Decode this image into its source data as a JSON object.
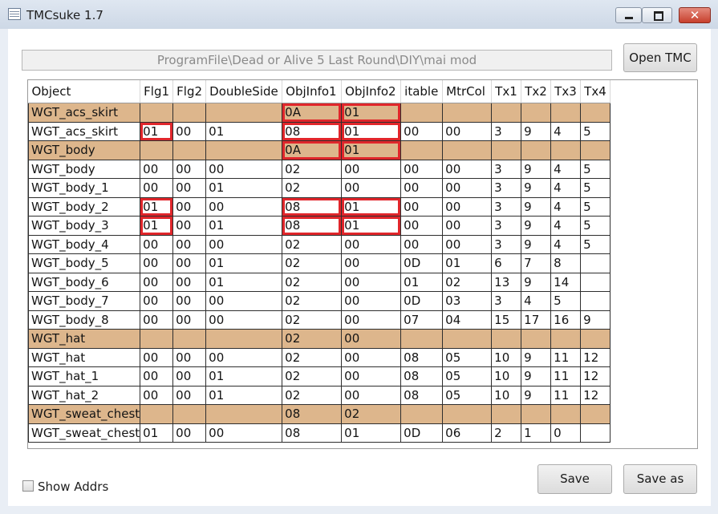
{
  "window": {
    "title": "TMCsuke 1.7",
    "buttons": {
      "minimize": "minimize",
      "maximize": "maximize",
      "close": "✕"
    }
  },
  "path": "ProgramFile\\Dead or Alive 5 Last Round\\DIY\\mai mod",
  "open_button": "Open TMC",
  "save_button": "Save",
  "save_as_button": "Save as",
  "show_addrs_label": "Show Addrs",
  "show_addrs_checked": false,
  "colors": {
    "group_row": "#ddb68c",
    "highlight": "#e0262b"
  },
  "grid": {
    "columns": [
      "Object",
      "Flg1",
      "Flg2",
      "DoubleSide",
      "ObjInfo1",
      "ObjInfo2",
      "itable",
      "MtrCol",
      "Tx1",
      "Tx2",
      "Tx3",
      "Tx4"
    ],
    "rows": [
      {
        "group": true,
        "cells": [
          "WGT_acs_skirt",
          "",
          "",
          "",
          "0A",
          "01",
          "",
          "",
          "",
          "",
          "",
          ""
        ],
        "highlight": [
          4,
          5
        ]
      },
      {
        "group": false,
        "cells": [
          "WGT_acs_skirt",
          "01",
          "00",
          "01",
          "08",
          "01",
          "00",
          "00",
          "3",
          "9",
          "4",
          "5"
        ],
        "highlight": [
          1,
          4,
          5
        ]
      },
      {
        "group": true,
        "cells": [
          "WGT_body",
          "",
          "",
          "",
          "0A",
          "01",
          "",
          "",
          "",
          "",
          "",
          ""
        ],
        "highlight": [
          4,
          5
        ]
      },
      {
        "group": false,
        "cells": [
          "WGT_body",
          "00",
          "00",
          "00",
          "02",
          "00",
          "00",
          "00",
          "3",
          "9",
          "4",
          "5"
        ],
        "highlight": []
      },
      {
        "group": false,
        "cells": [
          "WGT_body_1",
          "00",
          "00",
          "01",
          "02",
          "00",
          "00",
          "00",
          "3",
          "9",
          "4",
          "5"
        ],
        "highlight": []
      },
      {
        "group": false,
        "cells": [
          "WGT_body_2",
          "01",
          "00",
          "00",
          "08",
          "01",
          "00",
          "00",
          "3",
          "9",
          "4",
          "5"
        ],
        "highlight": [
          1,
          4,
          5
        ]
      },
      {
        "group": false,
        "cells": [
          "WGT_body_3",
          "01",
          "00",
          "01",
          "08",
          "01",
          "00",
          "00",
          "3",
          "9",
          "4",
          "5"
        ],
        "highlight": [
          1,
          4,
          5
        ]
      },
      {
        "group": false,
        "cells": [
          "WGT_body_4",
          "00",
          "00",
          "00",
          "02",
          "00",
          "00",
          "00",
          "3",
          "9",
          "4",
          "5"
        ],
        "highlight": []
      },
      {
        "group": false,
        "cells": [
          "WGT_body_5",
          "00",
          "00",
          "01",
          "02",
          "00",
          "0D",
          "01",
          "6",
          "7",
          "8",
          ""
        ],
        "highlight": []
      },
      {
        "group": false,
        "cells": [
          "WGT_body_6",
          "00",
          "00",
          "01",
          "02",
          "00",
          "01",
          "02",
          "13",
          "9",
          "14",
          ""
        ],
        "highlight": []
      },
      {
        "group": false,
        "cells": [
          "WGT_body_7",
          "00",
          "00",
          "00",
          "02",
          "00",
          "0D",
          "03",
          "3",
          "4",
          "5",
          ""
        ],
        "highlight": []
      },
      {
        "group": false,
        "cells": [
          "WGT_body_8",
          "00",
          "00",
          "00",
          "02",
          "00",
          "07",
          "04",
          "15",
          "17",
          "16",
          "9"
        ],
        "highlight": []
      },
      {
        "group": true,
        "cells": [
          "WGT_hat",
          "",
          "",
          "",
          "02",
          "00",
          "",
          "",
          "",
          "",
          "",
          ""
        ],
        "highlight": []
      },
      {
        "group": false,
        "cells": [
          "WGT_hat",
          "00",
          "00",
          "00",
          "02",
          "00",
          "08",
          "05",
          "10",
          "9",
          "11",
          "12"
        ],
        "highlight": []
      },
      {
        "group": false,
        "cells": [
          "WGT_hat_1",
          "00",
          "00",
          "01",
          "02",
          "00",
          "08",
          "05",
          "10",
          "9",
          "11",
          "12"
        ],
        "highlight": []
      },
      {
        "group": false,
        "cells": [
          "WGT_hat_2",
          "00",
          "00",
          "01",
          "02",
          "00",
          "08",
          "05",
          "10",
          "9",
          "11",
          "12"
        ],
        "highlight": []
      },
      {
        "group": true,
        "cells": [
          "WGT_sweat_chest",
          "",
          "",
          "",
          "08",
          "02",
          "",
          "",
          "",
          "",
          "",
          ""
        ],
        "highlight": []
      },
      {
        "group": false,
        "cells": [
          "WGT_sweat_chest",
          "01",
          "00",
          "00",
          "08",
          "01",
          "0D",
          "06",
          "2",
          "1",
          "0",
          ""
        ],
        "highlight": []
      }
    ]
  }
}
